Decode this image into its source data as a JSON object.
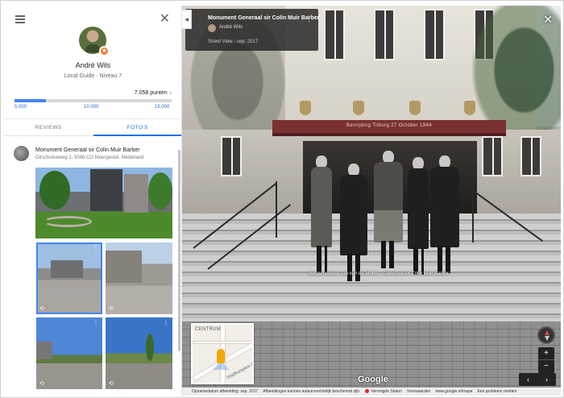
{
  "profile": {
    "name": "André Wils",
    "level": "Local Guide · Niveau 7",
    "points": "7.058 punten",
    "progress_fraction": 0.2,
    "ticks": [
      "5.000",
      "10.000",
      "15.000"
    ]
  },
  "tabs": [
    {
      "label": "REVIEWS",
      "active": false
    },
    {
      "label": "FOTO'S",
      "active": true
    }
  ],
  "place": {
    "title": "Monument Generaal sir Colin Muir Barber",
    "address": "Oirschotseweg 1, 5066 CG Moergestel, Nederland"
  },
  "streetview": {
    "title": "Monument Generaal sir Colin Muir Barber",
    "author": "André Wils",
    "date": "Street View - sep. 2017",
    "canopy_text": "Bevrijding Tilburg 27 October 1944",
    "caption_left": "Burgemeester Jan van de Mortel",
    "caption_right": "Generaal sir Colin Muir Barber",
    "minimap_label": "CENTRUM",
    "minimap_street": "Stadhuisplein Paleis",
    "google": "Google",
    "footer": [
      "Opnamedatum afbeelding: sep. 2017",
      "Afbeeldingen kunnen auteursrechtelijk beschermd zijn.",
      "Verenigde Staten",
      "Voorwaarden",
      "www.google.nl/mapa",
      "Een probleem melden"
    ]
  },
  "icons": {
    "menu": "menu-icon",
    "close": "close-icon",
    "panorama": "panorama-icon",
    "more": "more-vert-icon",
    "compass": "compass-icon",
    "collapse": "chevron-left-icon"
  },
  "colors": {
    "accent": "#4285f4",
    "badge": "#f07a28",
    "tab_active": "#1a73e8"
  }
}
